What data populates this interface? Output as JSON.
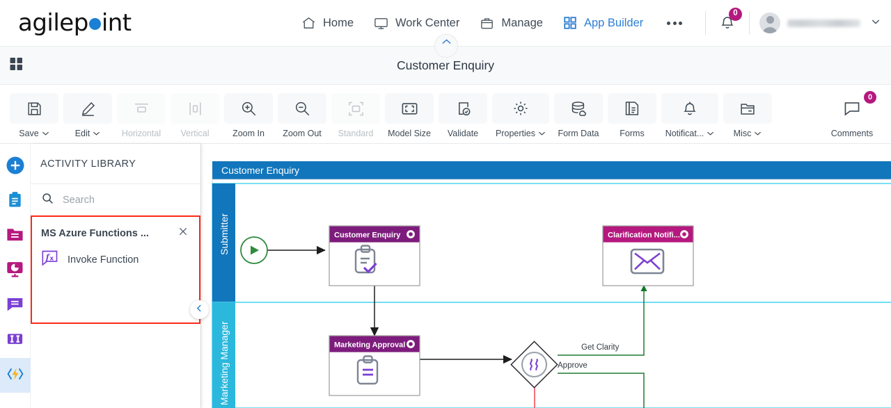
{
  "brand": {
    "name_part1": "agilep",
    "name_part2": "int",
    "dot_color": "#1b7fd4"
  },
  "topnav": {
    "items": [
      {
        "label": "Home",
        "icon": "home-icon",
        "active": false
      },
      {
        "label": "Work Center",
        "icon": "monitor-icon",
        "active": false
      },
      {
        "label": "Manage",
        "icon": "briefcase-icon",
        "active": false
      },
      {
        "label": "App Builder",
        "icon": "grid-icon",
        "active": true
      }
    ],
    "more_label": "more-options",
    "notification_count": "0",
    "username": "",
    "accent_active": "#2e7fd4",
    "badge_color": "#b5187e"
  },
  "titlebar": {
    "title": "Customer Enquiry",
    "apps_icon": "apps-grid-icon",
    "collapse_icon": "chevron-up-icon"
  },
  "toolbar": {
    "items": [
      {
        "label": "Save",
        "icon": "save-icon",
        "caret": true,
        "disabled": false,
        "badge": null
      },
      {
        "label": "Edit",
        "icon": "pencil-icon",
        "caret": true,
        "disabled": false,
        "badge": null
      },
      {
        "label": "Horizontal",
        "icon": "horizontal-icon",
        "caret": false,
        "disabled": true,
        "badge": null
      },
      {
        "label": "Vertical",
        "icon": "vertical-icon",
        "caret": false,
        "disabled": true,
        "badge": null
      },
      {
        "label": "Zoom In",
        "icon": "zoom-in-icon",
        "caret": false,
        "disabled": false,
        "badge": null
      },
      {
        "label": "Zoom Out",
        "icon": "zoom-out-icon",
        "caret": false,
        "disabled": false,
        "badge": null
      },
      {
        "label": "Standard",
        "icon": "standard-size-icon",
        "caret": false,
        "disabled": true,
        "badge": null
      },
      {
        "label": "Model Size",
        "icon": "model-size-icon",
        "caret": false,
        "disabled": false,
        "badge": null
      },
      {
        "label": "Validate",
        "icon": "validate-icon",
        "caret": false,
        "disabled": false,
        "badge": null
      },
      {
        "label": "Properties",
        "icon": "gear-icon",
        "caret": true,
        "disabled": false,
        "badge": null
      },
      {
        "label": "Form Data",
        "icon": "database-icon",
        "caret": false,
        "disabled": false,
        "badge": null
      },
      {
        "label": "Forms",
        "icon": "document-icon",
        "caret": false,
        "disabled": false,
        "badge": null
      },
      {
        "label": "Notificat...",
        "icon": "bell-icon",
        "caret": true,
        "disabled": false,
        "badge": null
      },
      {
        "label": "Misc",
        "icon": "folder-icon",
        "caret": true,
        "disabled": false,
        "badge": null
      },
      {
        "label": "Comments",
        "icon": "comment-icon",
        "caret": false,
        "disabled": false,
        "badge": "0"
      }
    ]
  },
  "rail": {
    "items": [
      {
        "name": "add-icon",
        "color": "#1b7fd4",
        "selected": false
      },
      {
        "name": "clipboard-icon",
        "color": "#1b8fd6",
        "selected": false
      },
      {
        "name": "folder-icon",
        "color": "#b5187e",
        "selected": false
      },
      {
        "name": "analytics-icon",
        "color": "#b5187e",
        "selected": false
      },
      {
        "name": "chat-icon",
        "color": "#7b3fd4",
        "selected": false
      },
      {
        "name": "columns-icon",
        "color": "#7b3fd4",
        "selected": false
      },
      {
        "name": "integration-icon",
        "color": "#f4b520",
        "selected": true
      }
    ]
  },
  "activity_library": {
    "header": "ACTIVITY LIBRARY",
    "search_placeholder": "Search",
    "search_value": "",
    "group": {
      "title": "MS Azure Functions ...",
      "close_icon": "close-icon",
      "items": [
        {
          "label": "Invoke Function",
          "icon": "fx-function-icon"
        }
      ]
    },
    "highlight_color": "#ff2a18",
    "collapse_icon": "chevron-left-icon"
  },
  "diagram": {
    "pool_title": "Customer Enquiry",
    "pool_header_color": "#1176bc",
    "lanes": [
      {
        "label": "Submitter",
        "color": "#1176bc"
      },
      {
        "label": "Marketing Manager",
        "color": "#2cb8dd"
      }
    ],
    "start_event": {
      "name": "start-event",
      "color": "#2e8b3d"
    },
    "tasks": [
      {
        "title": "Customer Enquiry",
        "icon": "clipboard-check-icon",
        "header_color": "#7d1c7c",
        "gear": "gear-icon"
      },
      {
        "title": "Clarification Notifi...",
        "icon": "envelope-icon",
        "header_color": "#b5187e",
        "gear": "gear-icon"
      },
      {
        "title": "Marketing Approval",
        "icon": "clipboard-lines-icon",
        "header_color": "#7d1c7c",
        "gear": "gear-icon"
      }
    ],
    "gateway": {
      "name": "inclusive-gateway",
      "symbol": "))"
    },
    "edge_labels": [
      "Get Clarity",
      "Approve"
    ],
    "edge_colors": {
      "default": "#1d1d1d",
      "approved": "#1f7a33",
      "rejected": "#f4616b"
    }
  }
}
